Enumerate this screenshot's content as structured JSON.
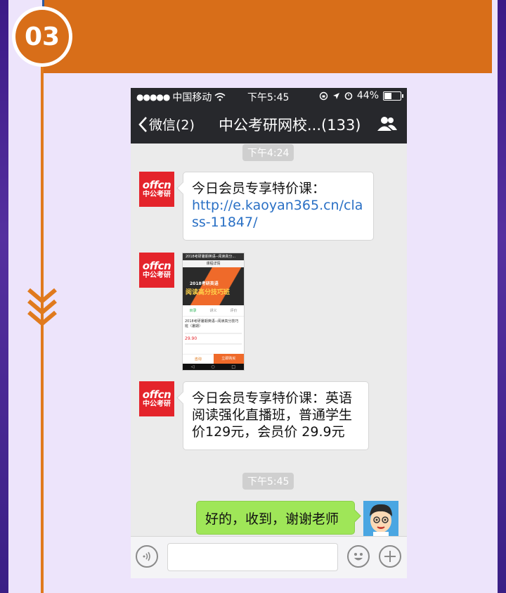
{
  "page": {
    "step_number": "03",
    "accent_color": "#d86e19",
    "background_color": "#ede4fb"
  },
  "phone": {
    "status_bar": {
      "carrier": "中国移动",
      "time": "下午5:45",
      "battery": "44%"
    },
    "nav": {
      "back_label": "微信(2)",
      "title": "中公考研网校...(133)",
      "group_icon": "people-icon"
    },
    "messages": [
      {
        "type": "time",
        "text": "下午4:24"
      },
      {
        "type": "text",
        "sender": "中公考研",
        "lines": [
          "今日会员专享特价课："
        ],
        "link": "http://e.kaoyan365.cn/class-11847/"
      },
      {
        "type": "image",
        "sender": "中公考研",
        "preview": {
          "top": "2018考研暑期英语--阅读高分...",
          "sub": "课程详情",
          "banner_line1": "2018考研英语",
          "banner_line2": "阅读高分技巧班",
          "tabs": [
            "目录",
            "讲义",
            "评价"
          ],
          "title": "2018考研暑期英语--阅读高分技巧班（暑期）",
          "price": "29.90",
          "btn_a": "咨询",
          "btn_b": "立即购买"
        }
      },
      {
        "type": "text",
        "sender": "中公考研",
        "lines": [
          "今日会员专享特价课：英语",
          "阅读强化直播班，普通学生",
          "价129元，会员价 29.9元"
        ]
      },
      {
        "type": "time",
        "text": "下午5:45"
      },
      {
        "type": "text",
        "sender": "me",
        "lines": [
          "好的，收到，谢谢老师"
        ]
      }
    ],
    "logo": {
      "line1": "offcn",
      "line2": "中公考研"
    },
    "input_bar": {
      "voice_icon": "voice-icon",
      "emoji_icon": "emoji-icon",
      "plus_icon": "plus-icon",
      "placeholder": ""
    }
  }
}
